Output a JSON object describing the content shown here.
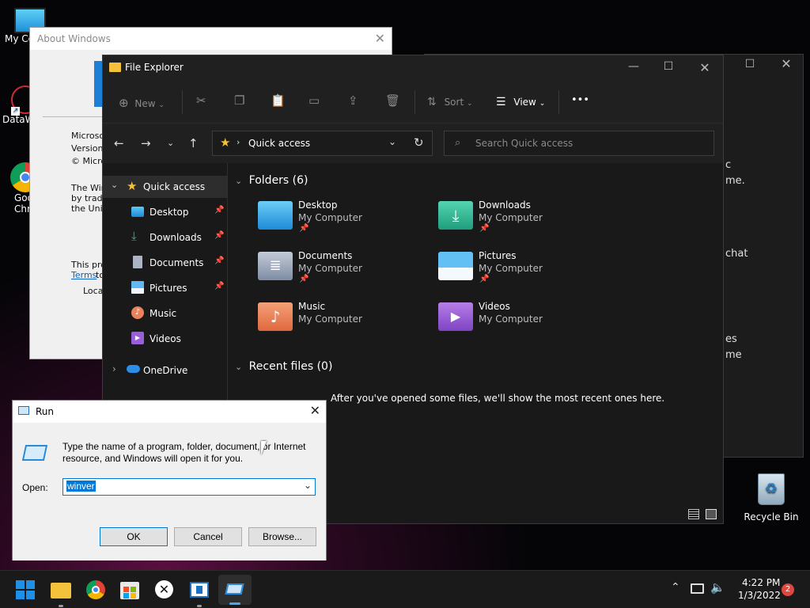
{
  "desktop": {
    "icons": [
      {
        "label": "My Co"
      },
      {
        "label": "DataW"
      },
      {
        "label": "Goo"
      },
      {
        "label": "Chr"
      },
      {
        "label": "Recycle Bin"
      }
    ]
  },
  "back_window": {
    "lines": [
      "c",
      "me.",
      "chat",
      "es",
      "me"
    ]
  },
  "about_windows": {
    "title": "About Windows",
    "lines": [
      "Microsof",
      "Version",
      "© Micros",
      "The Win",
      "by trade",
      "the Unit",
      "This prod",
      "Terms",
      "to",
      "Local"
    ]
  },
  "file_explorer": {
    "title": "File Explorer",
    "commands": {
      "new": "New",
      "sort": "Sort",
      "view": "View",
      "more": "•••"
    },
    "address": {
      "location": "Quick access"
    },
    "search": {
      "placeholder": "Search Quick access"
    },
    "nav": {
      "quick_access": "Quick access",
      "items": [
        {
          "label": "Desktop",
          "pinned": true
        },
        {
          "label": "Downloads",
          "pinned": true
        },
        {
          "label": "Documents",
          "pinned": true
        },
        {
          "label": "Pictures",
          "pinned": true
        },
        {
          "label": "Music",
          "pinned": false
        },
        {
          "label": "Videos",
          "pinned": false
        }
      ],
      "onedrive": "OneDrive"
    },
    "folders_header": "Folders (6)",
    "folders": [
      {
        "name": "Desktop",
        "location": "My Computer",
        "pinned": true,
        "color": "#3aa0e8"
      },
      {
        "name": "Downloads",
        "location": "My Computer",
        "pinned": true,
        "color": "#2fb894"
      },
      {
        "name": "Documents",
        "location": "My Computer",
        "pinned": true,
        "color": "#8a98b0"
      },
      {
        "name": "Pictures",
        "location": "My Computer",
        "pinned": true,
        "color": "#3f9ee6"
      },
      {
        "name": "Music",
        "location": "My Computer",
        "pinned": false,
        "color": "#e8825a"
      },
      {
        "name": "Videos",
        "location": "My Computer",
        "pinned": false,
        "color": "#9a5fd8"
      }
    ],
    "recent_header": "Recent files (0)",
    "recent_empty": "After you've opened some files, we'll show the most recent ones here."
  },
  "run_dialog": {
    "title": "Run",
    "description_line1": "Type the name of a program, folder, document, or Internet",
    "description_line2": "resource, and Windows will open it for you.",
    "open_label": "Open:",
    "open_value": "winver",
    "ok": "OK",
    "cancel": "Cancel",
    "browse": "Browse..."
  },
  "taskbar": {
    "time": "4:22 PM",
    "date": "1/3/2022",
    "notifications": "2"
  },
  "colors": {
    "accent": "#0078d7",
    "folder_yellow": "#f3c13a",
    "notification_badge": "#e0473e"
  }
}
